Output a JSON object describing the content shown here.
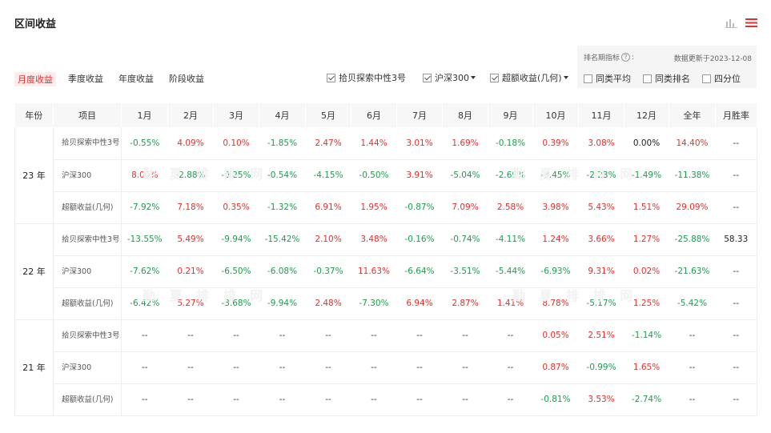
{
  "header": {
    "title": "区间收益"
  },
  "tabs": [
    {
      "label": "月度收益",
      "active": true
    },
    {
      "label": "季度收益",
      "active": false
    },
    {
      "label": "年度收益",
      "active": false
    },
    {
      "label": "阶段收益",
      "active": false
    }
  ],
  "filters": {
    "fund": {
      "label": "拾贝探索中性3号",
      "checked": true
    },
    "index": {
      "label": "沪深300",
      "checked": true
    },
    "excess": {
      "label": "超额收益(几何)",
      "checked": true
    }
  },
  "ranking": {
    "label": "排名期指标",
    "help_icon": "?",
    "suffix": ":",
    "update_text": "数据更新于2023-12-08",
    "options": [
      {
        "label": "同类平均",
        "checked": false
      },
      {
        "label": "同类排名",
        "checked": false
      },
      {
        "label": "四分位",
        "checked": false
      }
    ]
  },
  "watermark": "勤 夏 排 排 网",
  "table": {
    "headers": [
      "年份",
      "项目",
      "1月",
      "2月",
      "3月",
      "4月",
      "5月",
      "6月",
      "7月",
      "8月",
      "9月",
      "10月",
      "11月",
      "12月",
      "全年",
      "月胜率"
    ],
    "groups": [
      {
        "year": "23 年",
        "rows": [
          {
            "item": "拾贝探索中性3号",
            "values": [
              "-0.55%",
              "4.09%",
              "0.10%",
              "-1.85%",
              "2.47%",
              "1.44%",
              "3.01%",
              "1.69%",
              "-0.18%",
              "0.39%",
              "3.08%",
              "0.00%",
              "14.40%",
              "--"
            ]
          },
          {
            "item": "沪深300",
            "values": [
              "8.00%",
              "-2.88%",
              "-0.25%",
              "-0.54%",
              "-4.15%",
              "-0.50%",
              "3.91%",
              "-5.04%",
              "-2.69%",
              "-3.45%",
              "-2.23%",
              "-1.49%",
              "-11.38%",
              "--"
            ]
          },
          {
            "item": "超额收益(几何)",
            "values": [
              "-7.92%",
              "7.18%",
              "0.35%",
              "-1.32%",
              "6.91%",
              "1.95%",
              "-0.87%",
              "7.09%",
              "2.58%",
              "3.98%",
              "5.43%",
              "1.51%",
              "29.09%",
              "--"
            ]
          }
        ]
      },
      {
        "year": "22 年",
        "rows": [
          {
            "item": "拾贝探索中性3号",
            "values": [
              "-13.55%",
              "5.49%",
              "-9.94%",
              "-15.42%",
              "2.10%",
              "3.48%",
              "-0.16%",
              "-0.74%",
              "-4.11%",
              "1.24%",
              "3.66%",
              "1.27%",
              "-25.88%",
              "58.33"
            ]
          },
          {
            "item": "沪深300",
            "values": [
              "-7.62%",
              "0.21%",
              "-6.50%",
              "-6.08%",
              "-0.37%",
              "11.63%",
              "-6.64%",
              "-3.51%",
              "-5.44%",
              "-6.93%",
              "9.31%",
              "0.02%",
              "-21.63%",
              "--"
            ]
          },
          {
            "item": "超额收益(几何)",
            "values": [
              "-6.42%",
              "5.27%",
              "-3.68%",
              "-9.94%",
              "2.48%",
              "-7.30%",
              "6.94%",
              "2.87%",
              "1.41%",
              "8.78%",
              "-5.17%",
              "1.25%",
              "-5.42%",
              "--"
            ]
          }
        ]
      },
      {
        "year": "21 年",
        "rows": [
          {
            "item": "拾贝探索中性3号",
            "values": [
              "--",
              "--",
              "--",
              "--",
              "--",
              "--",
              "--",
              "--",
              "--",
              "0.05%",
              "2.51%",
              "-1.14%",
              "--",
              "--"
            ]
          },
          {
            "item": "沪深300",
            "values": [
              "--",
              "--",
              "--",
              "--",
              "--",
              "--",
              "--",
              "--",
              "--",
              "0.87%",
              "-0.99%",
              "1.65%",
              "--",
              "--"
            ]
          },
          {
            "item": "超额收益(几何)",
            "values": [
              "--",
              "--",
              "--",
              "--",
              "--",
              "--",
              "--",
              "--",
              "--",
              "-0.81%",
              "3.53%",
              "-2.74%",
              "--",
              "--"
            ]
          }
        ]
      }
    ]
  },
  "colors": {
    "positive": "#e0312c",
    "negative": "#1a9e4a",
    "accent": "#e0312c"
  },
  "icons": {
    "chart": "bar-chart-icon",
    "menu": "menu-icon"
  }
}
